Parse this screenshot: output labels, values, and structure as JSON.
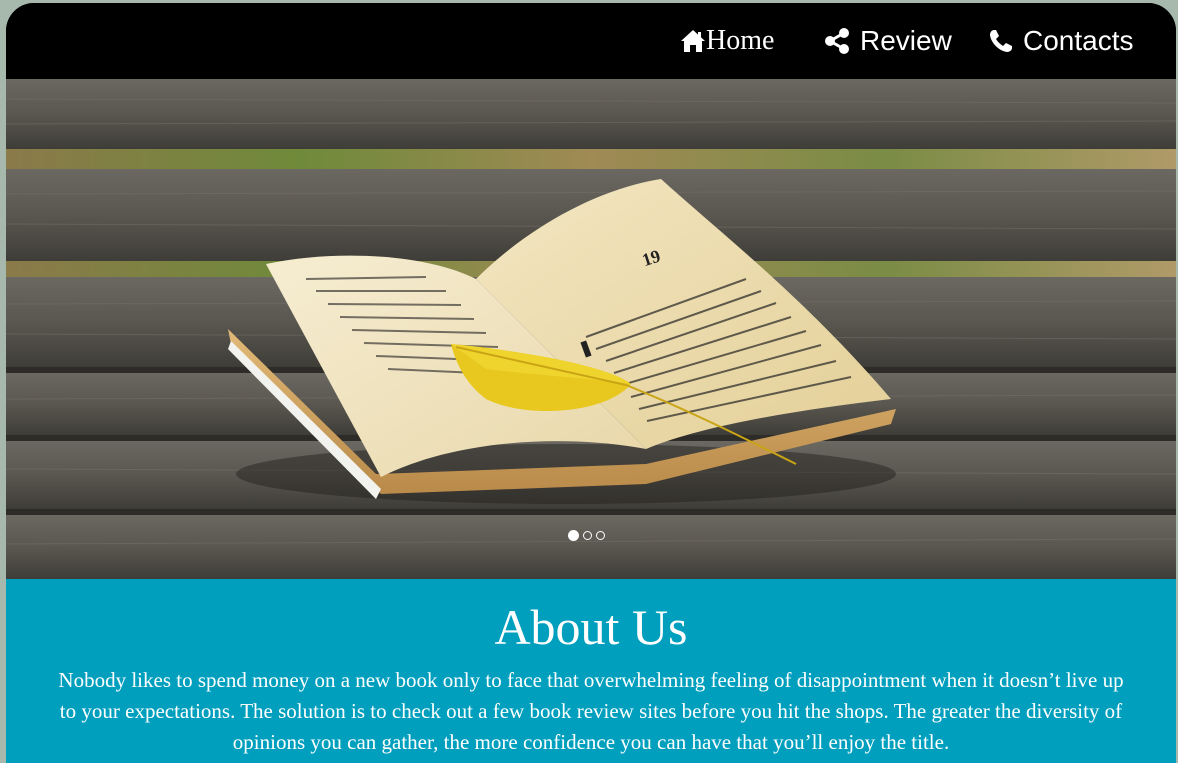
{
  "nav": {
    "home_label": "Home",
    "review_label": "Review",
    "contacts_label": "Contacts",
    "home_icon": "home-icon",
    "review_icon": "share-icon",
    "contacts_icon": "phone-icon"
  },
  "hero": {
    "page_number": "19",
    "slides_count": 3,
    "active_slide": 1
  },
  "about": {
    "title": "About Us",
    "text": "Nobody likes to spend money on a new book only to face that overwhelming feeling of disappointment when it doesn’t live up to your expectations. The solution is to check out a few book review sites before you hit the shops. The greater the diversity of opinions you can gather, the more confidence you can have that you’ll enjoy the title."
  },
  "colors": {
    "navbar": "#000000",
    "about_bg": "#009fbd",
    "outer_bg": "#a7b8ad",
    "text": "#ffffff"
  }
}
